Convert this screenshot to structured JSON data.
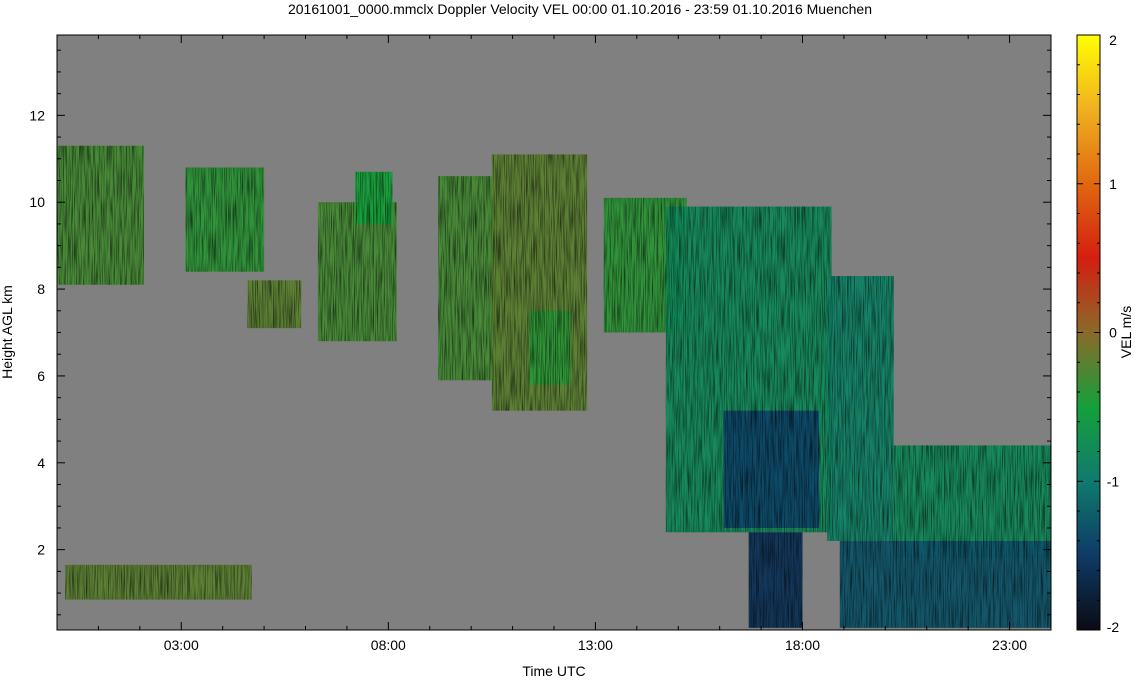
{
  "chart_data": {
    "type": "heatmap",
    "title": "20161001_0000.mmclx Doppler Velocity VEL   00:00 01.10.2016 - 23:59 01.10.2016 Muenchen",
    "xlabel": "Time UTC",
    "ylabel": "Height AGL km",
    "colorbar_label": "VEL m/s",
    "xlim": [
      0,
      24
    ],
    "ylim": [
      0.15,
      13.85
    ],
    "x_ticks": [
      {
        "value": 3,
        "label": "03:00"
      },
      {
        "value": 8,
        "label": "08:00"
      },
      {
        "value": 13,
        "label": "13:00"
      },
      {
        "value": 18,
        "label": "18:00"
      },
      {
        "value": 23,
        "label": "23:00"
      }
    ],
    "y_ticks": [
      {
        "value": 2,
        "label": "2"
      },
      {
        "value": 4,
        "label": "4"
      },
      {
        "value": 6,
        "label": "6"
      },
      {
        "value": 8,
        "label": "8"
      },
      {
        "value": 10,
        "label": "10"
      },
      {
        "value": 12,
        "label": "12"
      }
    ],
    "colorbar": {
      "range": [
        -2,
        2
      ],
      "ticks": [
        {
          "value": 2,
          "label": "2"
        },
        {
          "value": 1,
          "label": "1"
        },
        {
          "value": 0,
          "label": "0"
        },
        {
          "value": -1,
          "label": "-1"
        },
        {
          "value": -2,
          "label": "-2"
        }
      ],
      "colors": [
        "#0b0b14",
        "#0e3a66",
        "#0f7a6e",
        "#15a03a",
        "#8a6a2a",
        "#d41e10",
        "#e06810",
        "#f0b020",
        "#ffff00"
      ]
    },
    "background_color": "#808080",
    "echo_regions": [
      {
        "t": [
          0.0,
          2.1
        ],
        "h": [
          8.1,
          11.3
        ],
        "vel": -0.3
      },
      {
        "t": [
          3.1,
          5.0
        ],
        "h": [
          8.4,
          10.8
        ],
        "vel": -0.4
      },
      {
        "t": [
          4.6,
          5.9
        ],
        "h": [
          7.1,
          8.2
        ],
        "vel": -0.2
      },
      {
        "t": [
          6.3,
          8.2
        ],
        "h": [
          6.8,
          10.0
        ],
        "vel": -0.3
      },
      {
        "t": [
          7.2,
          8.1
        ],
        "h": [
          9.5,
          10.7
        ],
        "vel": -0.5
      },
      {
        "t": [
          9.2,
          10.7
        ],
        "h": [
          5.9,
          10.6
        ],
        "vel": -0.3
      },
      {
        "t": [
          10.5,
          12.8
        ],
        "h": [
          5.2,
          11.1
        ],
        "vel": -0.2
      },
      {
        "t": [
          11.4,
          12.4
        ],
        "h": [
          5.8,
          7.5
        ],
        "vel": -0.4
      },
      {
        "t": [
          13.2,
          15.2
        ],
        "h": [
          7.0,
          10.1
        ],
        "vel": -0.4
      },
      {
        "t": [
          14.7,
          18.7
        ],
        "h": [
          2.4,
          9.9
        ],
        "vel": -0.8
      },
      {
        "t": [
          16.1,
          18.4
        ],
        "h": [
          2.5,
          5.2
        ],
        "vel": -1.4
      },
      {
        "t": [
          18.6,
          20.2
        ],
        "h": [
          2.2,
          8.3
        ],
        "vel": -0.9
      },
      {
        "t": [
          20.2,
          24.0
        ],
        "h": [
          1.8,
          4.4
        ],
        "vel": -0.8
      },
      {
        "t": [
          0.2,
          4.7
        ],
        "h": [
          0.85,
          1.65
        ],
        "vel": -0.2
      },
      {
        "t": [
          16.7,
          18.0
        ],
        "h": [
          0.2,
          2.4
        ],
        "vel": -1.6
      },
      {
        "t": [
          18.9,
          24.0
        ],
        "h": [
          0.2,
          2.2
        ],
        "vel": -1.3
      }
    ]
  }
}
